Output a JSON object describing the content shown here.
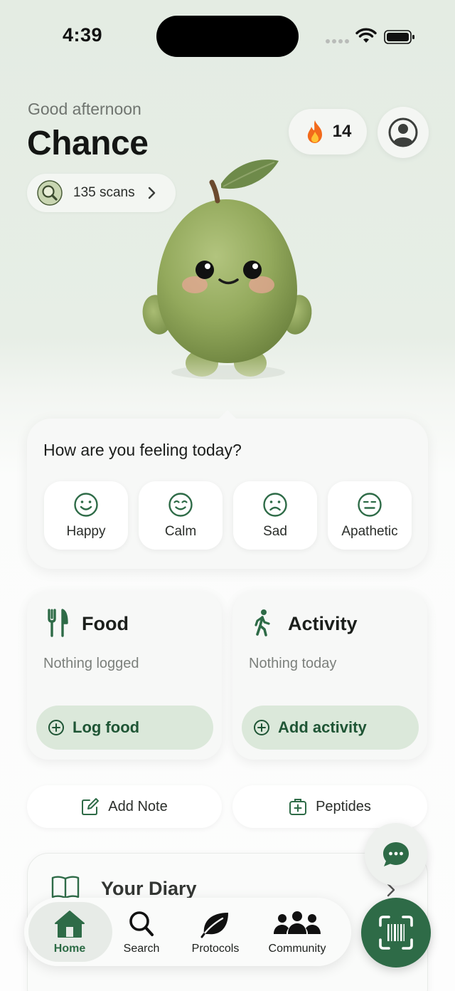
{
  "status_bar": {
    "time": "4:39"
  },
  "header": {
    "greeting": "Good afternoon",
    "user_name": "Chance",
    "scans_label": "135 scans",
    "streak_count": "14"
  },
  "mood": {
    "question": "How are you feeling today?",
    "options": [
      {
        "label": "Happy",
        "icon": "smile-icon"
      },
      {
        "label": "Calm",
        "icon": "calm-face-icon"
      },
      {
        "label": "Sad",
        "icon": "sad-face-icon"
      },
      {
        "label": "Apathetic",
        "icon": "neutral-face-icon"
      }
    ]
  },
  "food": {
    "title": "Food",
    "status": "Nothing logged",
    "button": "Log food"
  },
  "activity": {
    "title": "Activity",
    "status": "Nothing today",
    "button": "Add activity"
  },
  "quick_actions": {
    "add_note": "Add Note",
    "peptides": "Peptides"
  },
  "diary": {
    "title": "Your Diary"
  },
  "tabs": [
    {
      "label": "Home",
      "icon": "home-icon",
      "active": true
    },
    {
      "label": "Search",
      "icon": "search-icon",
      "active": false
    },
    {
      "label": "Protocols",
      "icon": "leaf-icon",
      "active": false
    },
    {
      "label": "Community",
      "icon": "people-icon",
      "active": false
    }
  ],
  "colors": {
    "accent": "#2e6b47",
    "accent_light": "#dbe8da",
    "background": "#e4ece3"
  }
}
